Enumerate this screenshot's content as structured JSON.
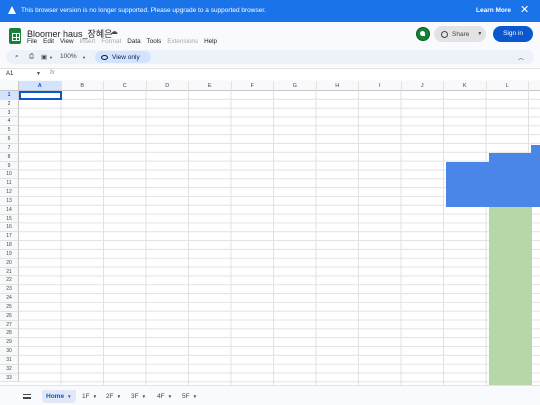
{
  "banner": {
    "message": "This browser version is no longer supported. Please upgrade to a supported browser.",
    "learn_more": "Learn More",
    "close": "✕"
  },
  "doc": {
    "title": "Bloomer haus_장혜은",
    "menus": [
      {
        "label": "File",
        "disabled": false
      },
      {
        "label": "Edit",
        "disabled": false
      },
      {
        "label": "View",
        "disabled": false
      },
      {
        "label": "Insert",
        "disabled": true
      },
      {
        "label": "Format",
        "disabled": true
      },
      {
        "label": "Data",
        "disabled": false
      },
      {
        "label": "Tools",
        "disabled": false
      },
      {
        "label": "Extensions",
        "disabled": true
      },
      {
        "label": "Help",
        "disabled": false
      }
    ]
  },
  "header": {
    "share_label": "Share",
    "signin_label": "Sign in"
  },
  "toolbar": {
    "zoom": "100%",
    "view_only": "View only"
  },
  "formula_bar": {
    "name_box": "A1",
    "fx": "fx"
  },
  "grid": {
    "columns": [
      "A",
      "B",
      "C",
      "D",
      "E",
      "F",
      "G",
      "H",
      "I",
      "J",
      "K",
      "L"
    ],
    "selected_column": "A",
    "selected_row": 1,
    "rows": [
      1,
      2,
      3,
      4,
      5,
      6,
      7,
      8,
      9,
      10,
      11,
      12,
      13,
      14,
      15,
      16,
      17,
      18,
      19,
      20,
      21,
      22,
      23,
      24,
      25,
      26,
      27,
      28,
      29,
      30,
      31,
      32,
      33
    ],
    "fill_colors": {
      "blue": "#4a86e8",
      "green": "#b6d7a8"
    }
  },
  "sheets": {
    "tabs": [
      "Home",
      "1F",
      "2F",
      "3F",
      "4F",
      "5F"
    ],
    "active": "Home"
  },
  "colors": {
    "accent": "#0b57d0",
    "banner": "#1a73e8"
  }
}
